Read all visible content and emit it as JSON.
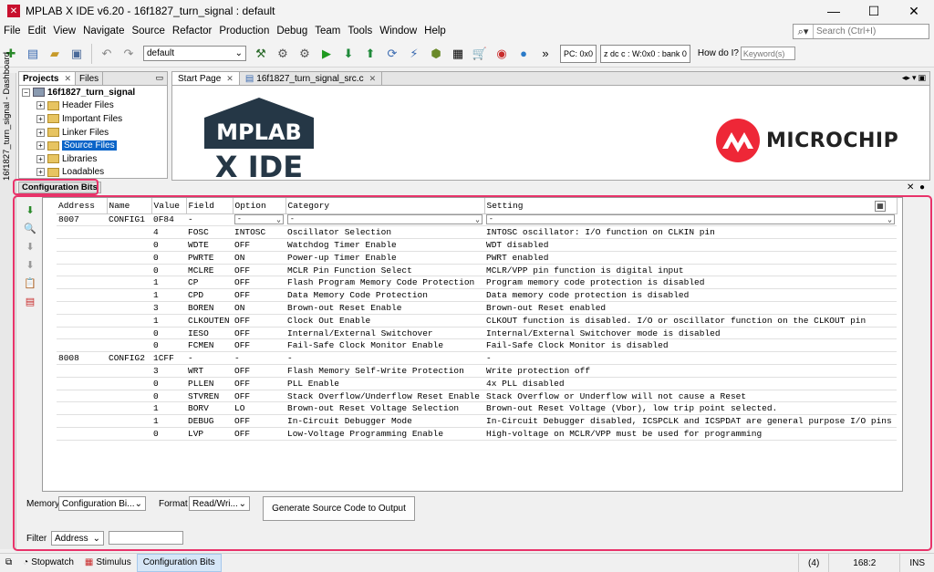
{
  "window": {
    "title": "MPLAB X IDE v6.20 - 16f1827_turn_signal : default",
    "minimize": "—",
    "maximize": "☐",
    "close": "✕"
  },
  "menu": [
    "File",
    "Edit",
    "View",
    "Navigate",
    "Source",
    "Refactor",
    "Production",
    "Debug",
    "Team",
    "Tools",
    "Window",
    "Help"
  ],
  "search": {
    "placeholder": "Search (Ctrl+I)"
  },
  "toolbar": {
    "config_value": "default",
    "pc": "PC: 0x0",
    "regs": "z dc c  : W:0x0 : bank 0",
    "howdoi": "How do I?",
    "keyword_placeholder": "Keyword(s)"
  },
  "left_strip": {
    "label": "16f1827_turn_signal - Dashboard"
  },
  "projects": {
    "tabs": [
      "Projects",
      "Files"
    ],
    "root": "16f1827_turn_signal",
    "nodes": [
      "Header Files",
      "Important Files",
      "Linker Files",
      "Source Files",
      "Libraries",
      "Loadables"
    ],
    "selected": "Source Files"
  },
  "editor": {
    "tabs": [
      "Start Page",
      "16f1827_turn_signal_src.c"
    ],
    "logo_text": [
      "MPLAB",
      "X IDE"
    ],
    "brand": "MICROCHIP"
  },
  "config_bits": {
    "panel_title": "Configuration Bits",
    "columns": [
      "Address",
      "Name",
      "Value",
      "Field",
      "Option",
      "Category",
      "Setting"
    ],
    "filter_row": {
      "option": "-",
      "category": "-",
      "setting": "-"
    },
    "rows": [
      {
        "address": "8007",
        "name": "CONFIG1",
        "value": "0F84",
        "field": "-",
        "option": "",
        "category": "",
        "setting": ""
      },
      {
        "address": "",
        "name": "",
        "value": "4",
        "field": "FOSC",
        "option": "INTOSC",
        "category": "Oscillator Selection",
        "setting": "INTOSC oscillator: I/O function on CLKIN pin"
      },
      {
        "address": "",
        "name": "",
        "value": "0",
        "field": "WDTE",
        "option": "OFF",
        "category": "Watchdog Timer Enable",
        "setting": "WDT disabled"
      },
      {
        "address": "",
        "name": "",
        "value": "0",
        "field": "PWRTE",
        "option": "ON",
        "category": "Power-up Timer Enable",
        "setting": "PWRT enabled"
      },
      {
        "address": "",
        "name": "",
        "value": "0",
        "field": "MCLRE",
        "option": "OFF",
        "category": "MCLR Pin Function Select",
        "setting": "MCLR/VPP pin function is digital input"
      },
      {
        "address": "",
        "name": "",
        "value": "1",
        "field": "CP",
        "option": "OFF",
        "category": "Flash Program Memory Code Protection",
        "setting": "Program memory code protection is disabled"
      },
      {
        "address": "",
        "name": "",
        "value": "1",
        "field": "CPD",
        "option": "OFF",
        "category": "Data Memory Code Protection",
        "setting": "Data memory code protection is disabled"
      },
      {
        "address": "",
        "name": "",
        "value": "3",
        "field": "BOREN",
        "option": "ON",
        "category": "Brown-out Reset Enable",
        "setting": "Brown-out Reset enabled"
      },
      {
        "address": "",
        "name": "",
        "value": "1",
        "field": "CLKOUTEN",
        "option": "OFF",
        "category": "Clock Out Enable",
        "setting": "CLKOUT function is disabled. I/O or oscillator function on the CLKOUT pin"
      },
      {
        "address": "",
        "name": "",
        "value": "0",
        "field": "IESO",
        "option": "OFF",
        "category": "Internal/External Switchover",
        "setting": "Internal/External Switchover mode is disabled"
      },
      {
        "address": "",
        "name": "",
        "value": "0",
        "field": "FCMEN",
        "option": "OFF",
        "category": "Fail-Safe Clock Monitor Enable",
        "setting": "Fail-Safe Clock Monitor is disabled"
      },
      {
        "address": "8008",
        "name": "CONFIG2",
        "value": "1CFF",
        "field": "-",
        "option": "-",
        "category": "-",
        "setting": "-"
      },
      {
        "address": "",
        "name": "",
        "value": "3",
        "field": "WRT",
        "option": "OFF",
        "category": "Flash Memory Self-Write Protection",
        "setting": "Write protection off"
      },
      {
        "address": "",
        "name": "",
        "value": "0",
        "field": "PLLEN",
        "option": "OFF",
        "category": "PLL Enable",
        "setting": "4x PLL disabled"
      },
      {
        "address": "",
        "name": "",
        "value": "0",
        "field": "STVREN",
        "option": "OFF",
        "category": "Stack Overflow/Underflow Reset Enable",
        "setting": "Stack Overflow or Underflow will not cause a Reset"
      },
      {
        "address": "",
        "name": "",
        "value": "1",
        "field": "BORV",
        "option": "LO",
        "category": "Brown-out Reset Voltage Selection",
        "setting": "Brown-out Reset Voltage (Vbor), low trip point selected."
      },
      {
        "address": "",
        "name": "",
        "value": "1",
        "field": "DEBUG",
        "option": "OFF",
        "category": "In-Circuit Debugger Mode",
        "setting": "In-Circuit Debugger disabled, ICSPCLK and ICSPDAT are general purpose I/O pins"
      },
      {
        "address": "",
        "name": "",
        "value": "0",
        "field": "LVP",
        "option": "OFF",
        "category": "Low-Voltage Programming Enable",
        "setting": "High-voltage on MCLR/VPP must be used for programming"
      }
    ],
    "memory_label": "Memory",
    "memory_value": "Configuration Bi...",
    "format_label": "Format",
    "format_value": "Read/Wri...",
    "generate_button": "Generate Source Code to Output",
    "filter_label": "Filter",
    "filter_value": "Address"
  },
  "statusbar": {
    "items": [
      "Stopwatch",
      "Stimulus",
      "Configuration Bits"
    ],
    "notifications": "4",
    "position": "168:2",
    "mode": "INS"
  },
  "colors": {
    "highlight": "#e8336a",
    "microchip_red": "#ee2737",
    "selection": "#0a64c8"
  }
}
